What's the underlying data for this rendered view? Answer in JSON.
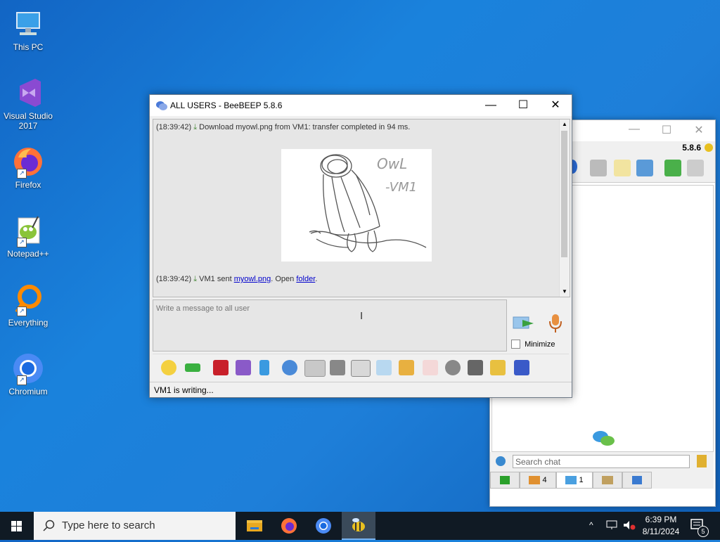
{
  "desktop": {
    "icons": [
      {
        "label": "This PC"
      },
      {
        "label": "Visual Studio 2017"
      },
      {
        "label": "Firefox"
      },
      {
        "label": "Notepad++"
      },
      {
        "label": "Everything"
      },
      {
        "label": "Chromium"
      }
    ]
  },
  "back_window": {
    "version": "5.8.6",
    "search_placeholder": "Search chat",
    "tabs": [
      {
        "icon": "green-screen-icon",
        "count": ""
      },
      {
        "icon": "users-icon",
        "count": "4"
      },
      {
        "icon": "chat-bubbles-icon",
        "count": "1"
      },
      {
        "icon": "groups-icon",
        "count": ""
      },
      {
        "icon": "flag-icon",
        "count": ""
      }
    ]
  },
  "chat_window": {
    "title": "ALL USERS - BeeBEEP 5.8.6",
    "messages": [
      {
        "time": "(18:39:42)",
        "text": "Download myowl.png from VM1: transfer completed in 94 ms."
      }
    ],
    "sent": {
      "time": "(18:39:42)",
      "prefix": "VM1 sent",
      "file": "myowl.png",
      "mid": ". Open",
      "folder": "folder",
      "end": "."
    },
    "owl_text": [
      "OwL",
      "-VM1"
    ],
    "input_placeholder": "Write a message to all user",
    "minimize_label": "Minimize",
    "status": "VM1 is writing..."
  },
  "taskbar": {
    "search_placeholder": "Type here to search",
    "time": "6:39 PM",
    "date": "8/11/2024",
    "notifications": "5"
  },
  "colors": {
    "desktop": "#1a7ad6",
    "taskbar": "#101a24",
    "link": "#0000cc"
  }
}
